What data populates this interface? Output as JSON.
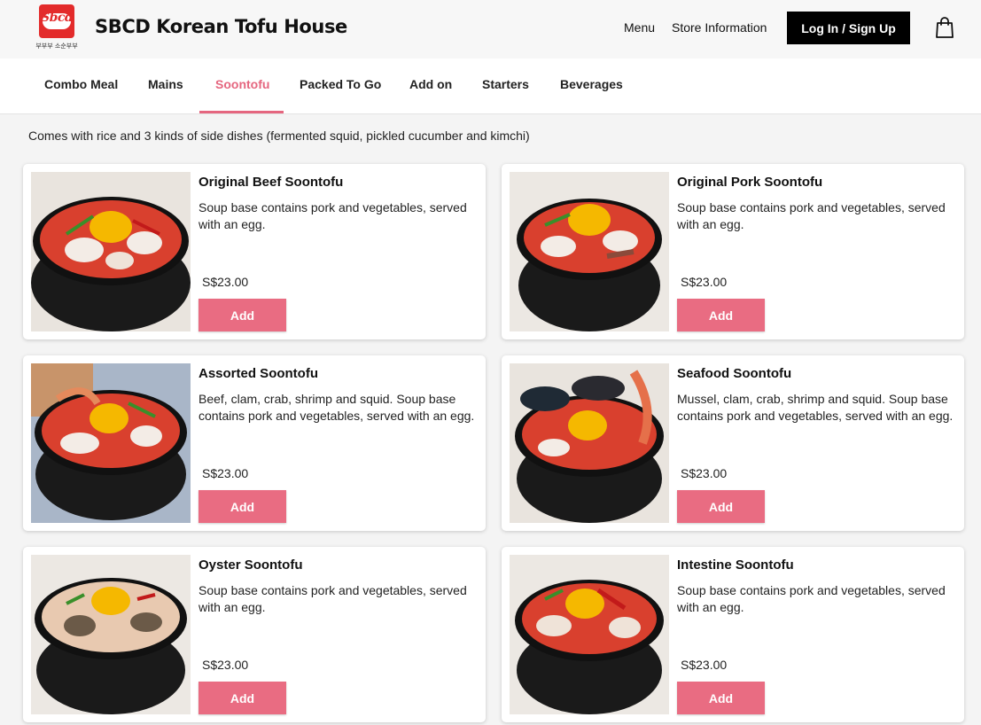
{
  "header": {
    "logo_text": "Sbcd",
    "logo_subtext": "부부부 소순부부",
    "brand": "SBCD Korean Tofu House",
    "links": [
      "Menu",
      "Store Information"
    ],
    "login_label": "Log In / Sign Up"
  },
  "tabs": [
    "Combo Meal",
    "Mains",
    "Soontofu",
    "Packed To Go",
    "Add on",
    "Starters",
    "Beverages"
  ],
  "active_tab": "Soontofu",
  "intro": "Comes with rice and 3 kinds of side dishes (fermented squid, pickled cucumber and kimchi)",
  "add_label": "Add",
  "items": [
    {
      "name": "Original Beef Soontofu",
      "desc": "Soup base contains pork and vegetables, served with an egg.",
      "price": "S$23.00"
    },
    {
      "name": "Original Pork Soontofu",
      "desc": "Soup base contains pork and vegetables, served with an egg.",
      "price": "S$23.00"
    },
    {
      "name": "Assorted Soontofu",
      "desc": "Beef, clam, crab, shrimp and squid. Soup base contains pork and vegetables, served with an egg.",
      "price": "S$23.00"
    },
    {
      "name": "Seafood Soontofu",
      "desc": "Mussel, clam, crab, shrimp and squid. Soup base contains pork and vegetables, served with an egg.",
      "price": "S$23.00"
    },
    {
      "name": "Oyster Soontofu",
      "desc": "Soup base contains pork and vegetables, served with an egg.",
      "price": "S$23.00"
    },
    {
      "name": "Intestine Soontofu",
      "desc": "Soup base contains pork and vegetables, served with an egg.",
      "price": "S$23.00"
    }
  ],
  "colors": {
    "accent": "#e5667f",
    "button": "#e96c82",
    "broth": "#d9402e"
  }
}
